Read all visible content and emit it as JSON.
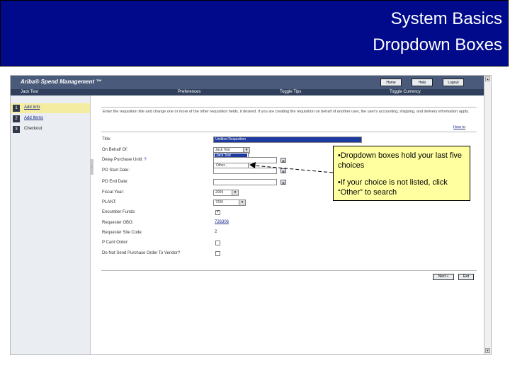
{
  "slide": {
    "title_line1": "System Basics",
    "title_line2": "Dropdown  Boxes"
  },
  "app": {
    "logo": "Ariba® Spend Management ™",
    "top_buttons": [
      "Home",
      "Help",
      "Logout"
    ],
    "user_name": "Jack Test",
    "menu": [
      "Preferences",
      "Toggle Tips",
      "Toggle Currency"
    ]
  },
  "nav": {
    "steps": [
      {
        "num": "1",
        "label": "Add Info",
        "active": true
      },
      {
        "num": "2",
        "label": "Add Items",
        "active": false
      },
      {
        "num": "3",
        "label": "Checkout",
        "active": false
      }
    ]
  },
  "main": {
    "instructions": "Enter the requisition title and change one or more of the other requisition fields, if desired. If you are creating the requisition on behalf of another user, the user's accounting, shipping, and delivery information apply.",
    "how_to": "How to",
    "help_marker": "?",
    "fields": {
      "title_label": "Title:",
      "title_value": "Untitled Requisition",
      "on_behalf_label": "On Behalf Of:",
      "on_behalf_value": "Jack Test",
      "on_behalf_options": [
        "Jack Test",
        "Other..."
      ],
      "delay_label": "Delay Purchase Until:",
      "po_start_label": "PO Start Date:",
      "po_end_label": "PO End Date:",
      "fiscal_year_label": "Fiscal Year:",
      "fiscal_year_value": "2009",
      "plant_label": "PLANT:",
      "plant_value": "7200",
      "encumber_label": "Encumber Funds:",
      "encumber_checked": true,
      "requester_obo_label": "Requester OBO:",
      "requester_obo_value": "726306",
      "requester_site_label": "Requester Site Code:",
      "requester_site_value": "2",
      "pcard_label": "P Card Order:",
      "donotsend_label": "Do Not Send Purchase Order To Vendor?"
    },
    "next_label": "Next »",
    "exit_label": "Exit"
  },
  "callout": {
    "line1": "•Dropdown boxes hold your last five choices",
    "line2": "•If your choice is not listed, click “Other” to search"
  },
  "icons": {
    "calendar": "calendar-icon",
    "dropdown": "chevron-down-icon",
    "scroll_up": "scroll-up-icon",
    "scroll_down": "scroll-down-icon"
  },
  "colors": {
    "banner": "#000a8a",
    "callout_bg": "#ffffa0",
    "header_bar": "#4a5a7a",
    "selection": "#1d3aa0"
  }
}
